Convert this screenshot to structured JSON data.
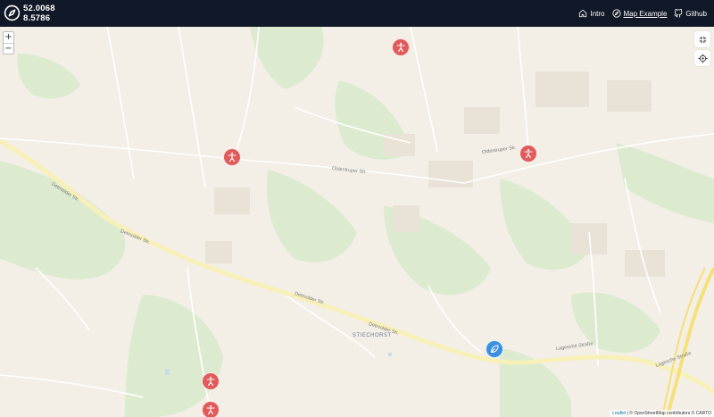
{
  "header": {
    "latitude": "52.0068",
    "longitude": "8.5786",
    "logo_icon": "compass-icon",
    "nav": [
      {
        "label": "Intro",
        "icon": "home-icon",
        "active": false
      },
      {
        "label": "Map Example",
        "icon": "compass-icon",
        "active": true
      },
      {
        "label": "Github",
        "icon": "github-icon",
        "active": false
      }
    ]
  },
  "map": {
    "zoom_in_label": "+",
    "zoom_out_label": "−",
    "fullscreen_icon": "minimize-icon",
    "locate_icon": "locate-icon",
    "labels": {
      "district": "STIECHORST",
      "road_1": "Detmolder Str.",
      "road_2": "Detmolder Str.",
      "road_3": "Detmolder Str.",
      "road_4": "Detmolder Str.",
      "road_5": "Oldentruper Str.",
      "road_6": "Oldentruper Str.",
      "road_7": "Lageschö Straße",
      "road_8": "Lagesche Straße"
    },
    "markers": [
      {
        "type": "person",
        "color": "#e05a5a"
      },
      {
        "type": "person",
        "color": "#e05a5a"
      },
      {
        "type": "person",
        "color": "#e05a5a"
      },
      {
        "type": "person",
        "color": "#e05a5a"
      },
      {
        "type": "person",
        "color": "#e05a5a"
      },
      {
        "type": "leaf",
        "color": "#3b8fe0"
      }
    ],
    "attribution_leaflet": "Leaflet",
    "attribution_rest": " | © OpenStreetMap contributors © CARTO"
  },
  "colors": {
    "header_bg": "#111827",
    "map_bg": "#f3efe6",
    "park": "#dcebd0",
    "road_major": "#f7f0b8",
    "marker_red": "#e05a5a",
    "marker_blue": "#3b8fe0"
  }
}
